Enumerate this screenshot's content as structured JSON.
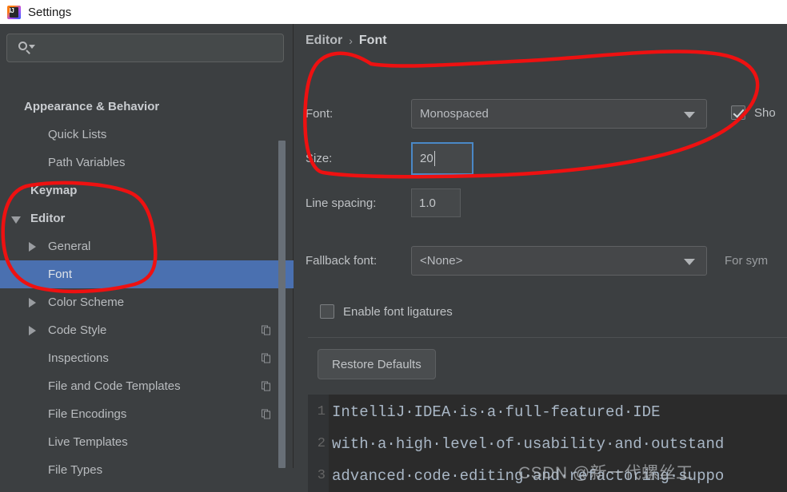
{
  "window": {
    "title": "Settings",
    "app_icon": "intellij-idea-logo"
  },
  "sidebar": {
    "search": {
      "value": "",
      "placeholder": "",
      "icon": "search-icon"
    },
    "items": [
      {
        "label": "Appearance & Behavior",
        "indent": 30,
        "bold": true,
        "twisty": "none",
        "selected": false,
        "copy": false
      },
      {
        "label": "Quick Lists",
        "indent": 60,
        "bold": false,
        "twisty": "none",
        "selected": false,
        "copy": false
      },
      {
        "label": "Path Variables",
        "indent": 60,
        "bold": false,
        "twisty": "none",
        "selected": false,
        "copy": false
      },
      {
        "label": "Keymap",
        "indent": 38,
        "bold": true,
        "twisty": "none",
        "selected": false,
        "copy": false
      },
      {
        "label": "Editor",
        "indent": 38,
        "bold": true,
        "twisty": "down",
        "selected": false,
        "copy": false
      },
      {
        "label": "General",
        "indent": 60,
        "bold": false,
        "twisty": "right",
        "selected": false,
        "copy": false
      },
      {
        "label": "Font",
        "indent": 60,
        "bold": false,
        "twisty": "none",
        "selected": true,
        "copy": false
      },
      {
        "label": "Color Scheme",
        "indent": 60,
        "bold": false,
        "twisty": "right",
        "selected": false,
        "copy": false
      },
      {
        "label": "Code Style",
        "indent": 60,
        "bold": false,
        "twisty": "right",
        "selected": false,
        "copy": true
      },
      {
        "label": "Inspections",
        "indent": 60,
        "bold": false,
        "twisty": "none",
        "selected": false,
        "copy": true
      },
      {
        "label": "File and Code Templates",
        "indent": 60,
        "bold": false,
        "twisty": "none",
        "selected": false,
        "copy": true
      },
      {
        "label": "File Encodings",
        "indent": 60,
        "bold": false,
        "twisty": "none",
        "selected": false,
        "copy": true
      },
      {
        "label": "Live Templates",
        "indent": 60,
        "bold": false,
        "twisty": "none",
        "selected": false,
        "copy": false
      },
      {
        "label": "File Types",
        "indent": 60,
        "bold": false,
        "twisty": "none",
        "selected": false,
        "copy": false
      }
    ]
  },
  "content": {
    "breadcrumb": {
      "parent": "Editor",
      "separator": "›",
      "current": "Font"
    },
    "font": {
      "label": "Font:",
      "value": "Monospaced"
    },
    "show_only_monospaced": {
      "label": "Sho",
      "checked": true
    },
    "size": {
      "label": "Size:",
      "value": "20"
    },
    "line_spacing": {
      "label": "Line spacing:",
      "value": "1.0"
    },
    "fallback_font": {
      "label": "Fallback font:",
      "value": "<None>",
      "hint": "For sym"
    },
    "ligatures": {
      "label": "Enable font ligatures",
      "checked": false
    },
    "restore_defaults_label": "Restore Defaults",
    "preview": {
      "lines": [
        {
          "number": "1",
          "text": "IntelliJ·IDEA·is·a·full-featured·IDE"
        },
        {
          "number": "2",
          "text": "with·a·high·level·of·usability·and·outstand"
        },
        {
          "number": "3",
          "text": "advanced·code·editing·and·refactoring·suppo"
        }
      ]
    }
  },
  "watermark": "CSDN @新一代螺丝工",
  "annotations": {
    "color": "#ee1111",
    "shapes": [
      "ellipse-around-editor-font-tree-items",
      "ellipse-around-font-size-controls"
    ]
  },
  "colors": {
    "titlebar_bg": "#ffffff",
    "dialog_bg": "#3c3f41",
    "selection_blue": "#4a70b0",
    "focus_border": "#4a88c7",
    "editor_bg": "#2b2b2b",
    "annotation_red": "#ee1111"
  }
}
